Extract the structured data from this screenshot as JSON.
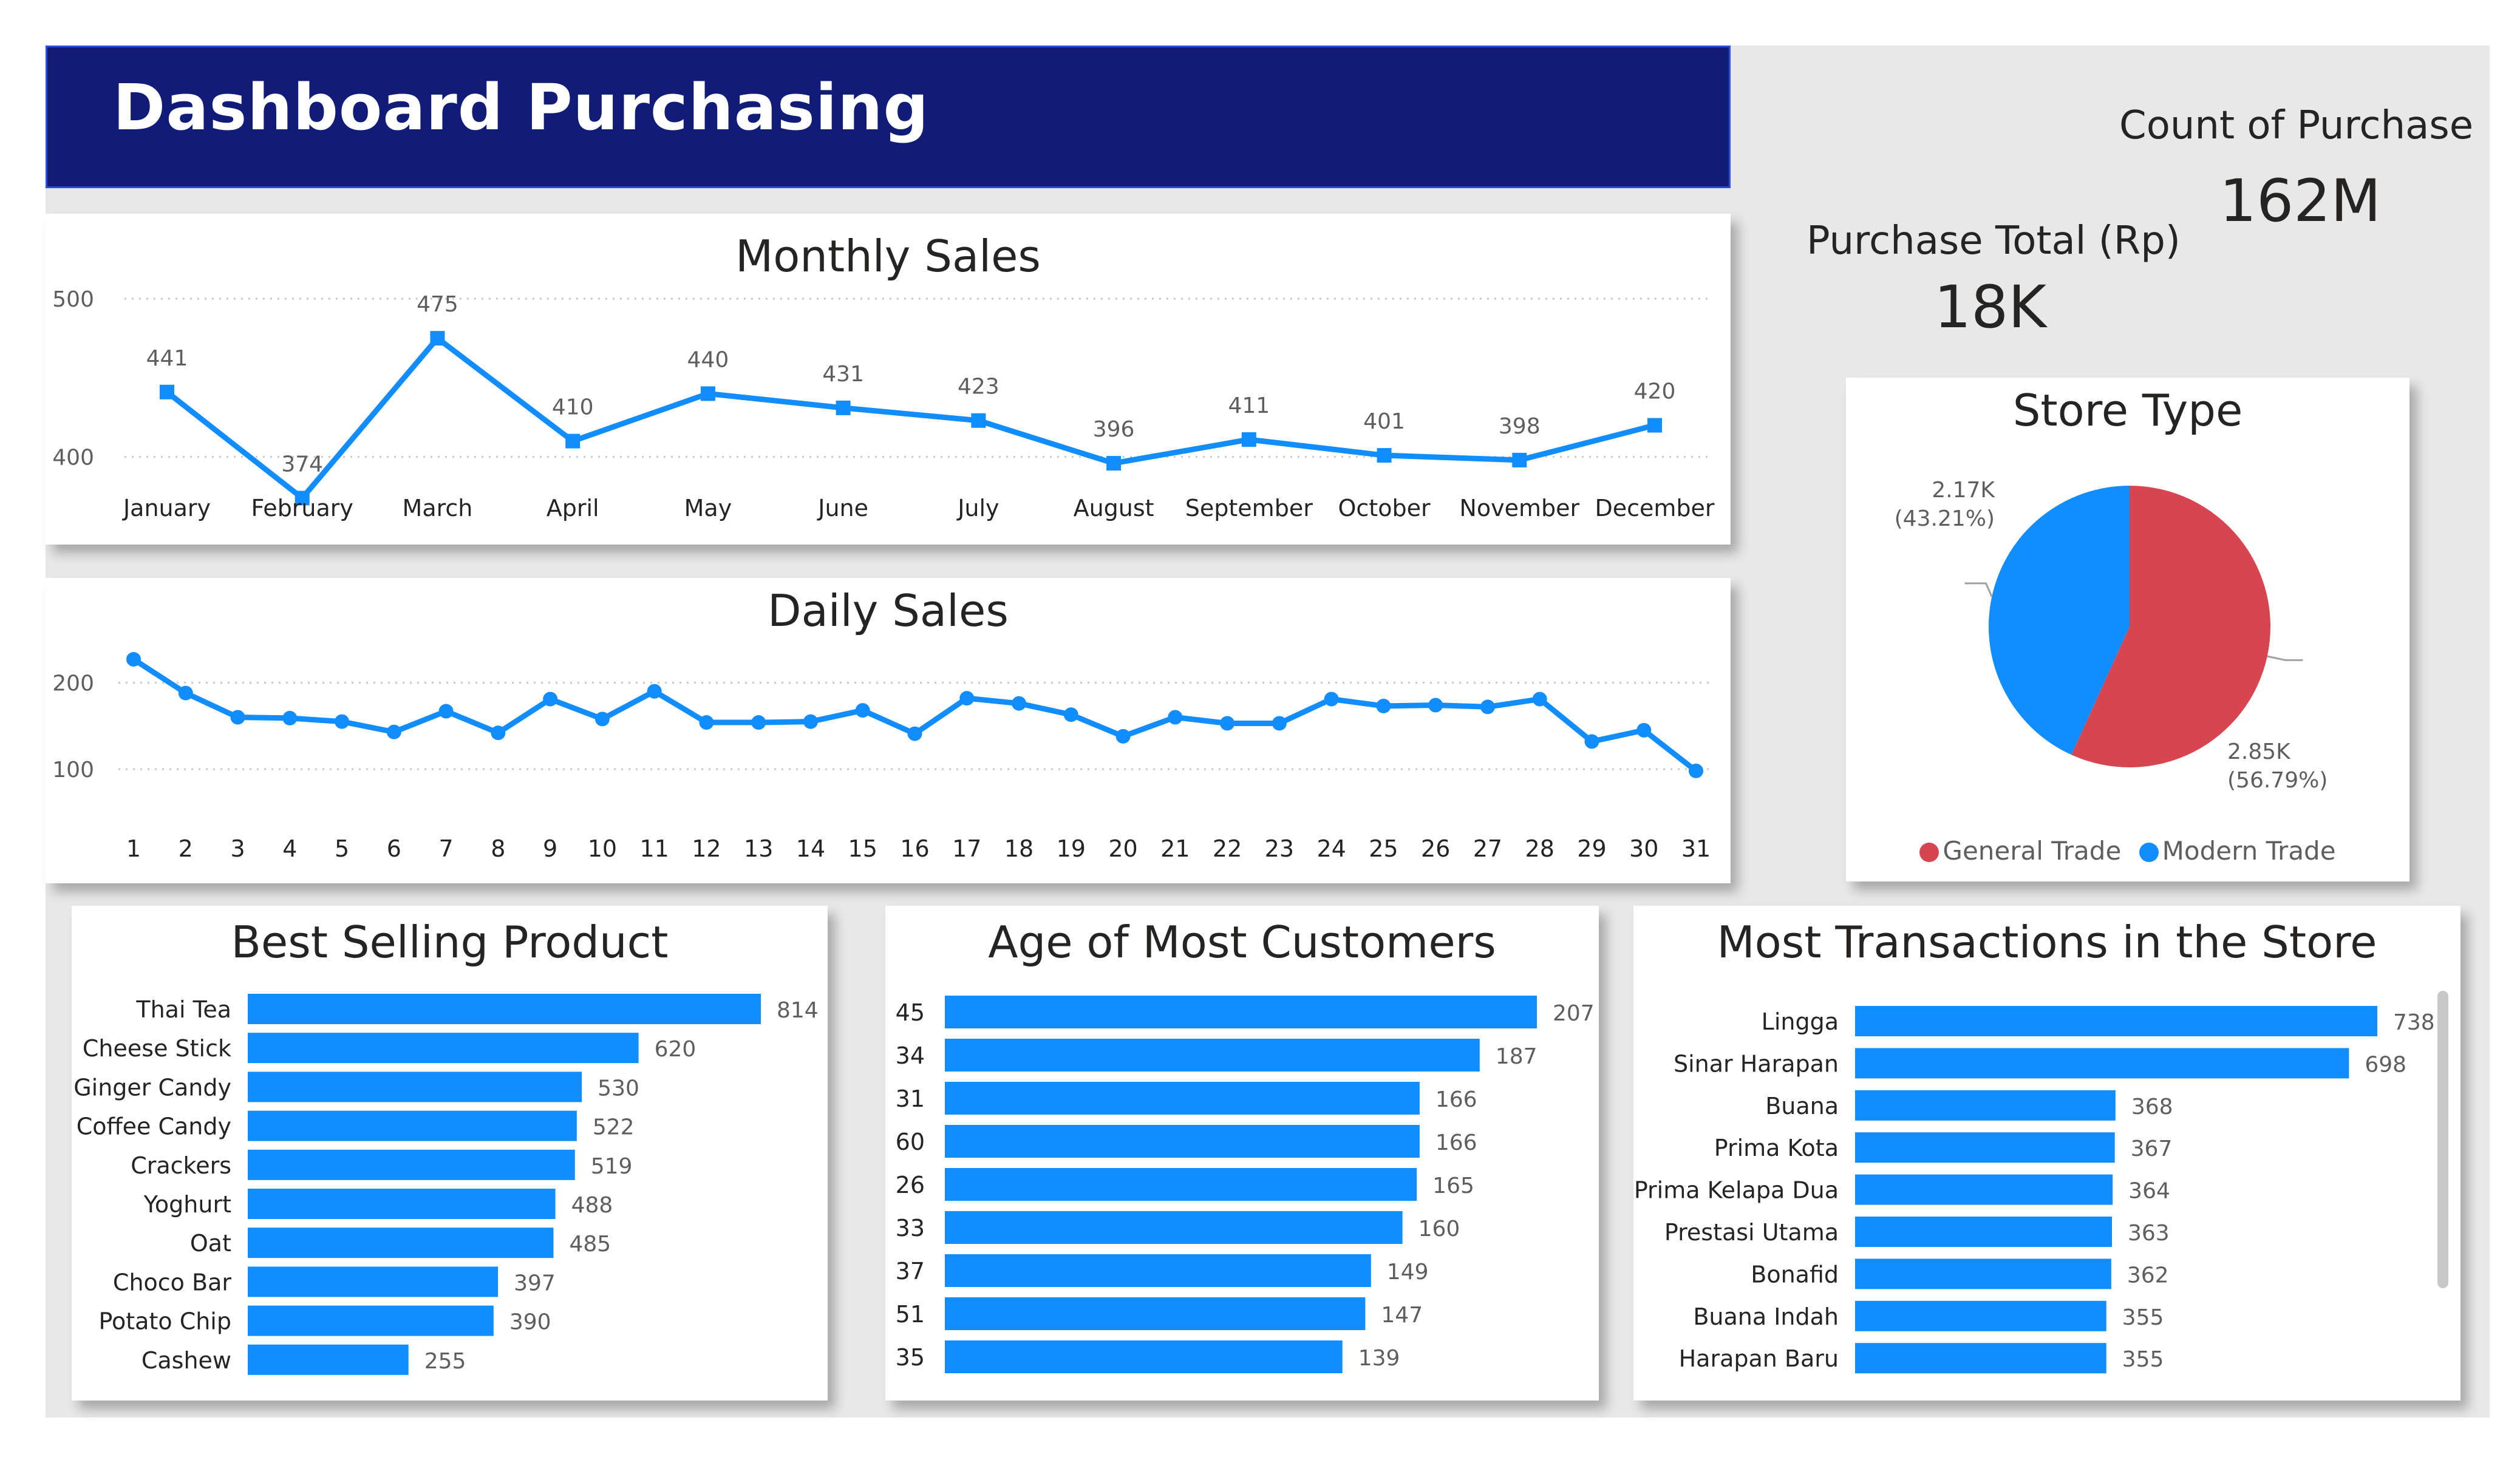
{
  "header": {
    "title": "Dashboard Purchasing"
  },
  "kpis": {
    "count_label": "Count of Purchase",
    "count_value": "162M",
    "total_label": "Purchase Total (Rp)",
    "total_value": "18K"
  },
  "colors": {
    "accent": "#118dff",
    "header_bg": "#111c78",
    "general_trade": "#d64550",
    "modern_trade": "#118dff"
  },
  "chart_data": [
    {
      "id": "monthly",
      "type": "line",
      "title": "Monthly Sales",
      "categories": [
        "January",
        "February",
        "March",
        "April",
        "May",
        "June",
        "July",
        "August",
        "September",
        "October",
        "November",
        "December"
      ],
      "values": [
        441,
        374,
        475,
        410,
        440,
        431,
        423,
        396,
        411,
        401,
        398,
        420
      ],
      "ylim": [
        350,
        500
      ],
      "yticks": [
        400,
        500
      ],
      "grid": true,
      "markers": "square"
    },
    {
      "id": "daily",
      "type": "line",
      "title": "Daily Sales",
      "categories": [
        "1",
        "2",
        "3",
        "4",
        "5",
        "6",
        "7",
        "8",
        "9",
        "10",
        "11",
        "12",
        "13",
        "14",
        "15",
        "16",
        "17",
        "18",
        "19",
        "20",
        "21",
        "22",
        "23",
        "24",
        "25",
        "26",
        "27",
        "28",
        "29",
        "30",
        "31"
      ],
      "values": [
        227,
        188,
        160,
        159,
        155,
        143,
        167,
        142,
        181,
        158,
        190,
        154,
        154,
        155,
        168,
        141,
        182,
        176,
        163,
        138,
        160,
        153,
        153,
        181,
        173,
        174,
        172,
        181,
        132,
        145,
        98
      ],
      "ylim": [
        60,
        260
      ],
      "yticks": [
        100,
        200
      ],
      "grid": true,
      "markers": "circle"
    },
    {
      "id": "store_type",
      "type": "pie",
      "title": "Store Type",
      "categories": [
        "General Trade",
        "Modern Trade"
      ],
      "values": [
        2850,
        2170
      ],
      "percents": [
        56.79,
        43.21
      ],
      "labels": [
        "2.85K",
        "2.17K"
      ],
      "pct_labels": [
        "(56.79%)",
        "(43.21%)"
      ],
      "colors": [
        "#d64550",
        "#118dff"
      ],
      "legend": "bottom"
    },
    {
      "id": "best_selling",
      "type": "bar",
      "orientation": "horizontal",
      "title": "Best Selling Product",
      "categories": [
        "Thai Tea",
        "Cheese Stick",
        "Ginger Candy",
        "Coffee Candy",
        "Crackers",
        "Yoghurt",
        "Oat",
        "Choco Bar",
        "Potato Chip",
        "Cashew"
      ],
      "values": [
        814,
        620,
        530,
        522,
        519,
        488,
        485,
        397,
        390,
        255
      ],
      "xlim": [
        0,
        814
      ]
    },
    {
      "id": "age",
      "type": "bar",
      "orientation": "horizontal",
      "title": "Age of Most Customers",
      "categories": [
        "45",
        "34",
        "31",
        "60",
        "26",
        "33",
        "37",
        "51",
        "35"
      ],
      "values": [
        207,
        187,
        166,
        166,
        165,
        160,
        149,
        147,
        139
      ],
      "xlim": [
        0,
        207
      ]
    },
    {
      "id": "transactions",
      "type": "bar",
      "orientation": "horizontal",
      "title": "Most Transactions in the Store",
      "categories": [
        "Lingga",
        "Sinar Harapan",
        "Buana",
        "Prima Kota",
        "Prima Kelapa Dua",
        "Prestasi Utama",
        "Bonafid",
        "Buana Indah",
        "Harapan Baru"
      ],
      "values": [
        738,
        698,
        368,
        367,
        364,
        363,
        362,
        355,
        355
      ],
      "xlim": [
        0,
        738
      ]
    }
  ]
}
